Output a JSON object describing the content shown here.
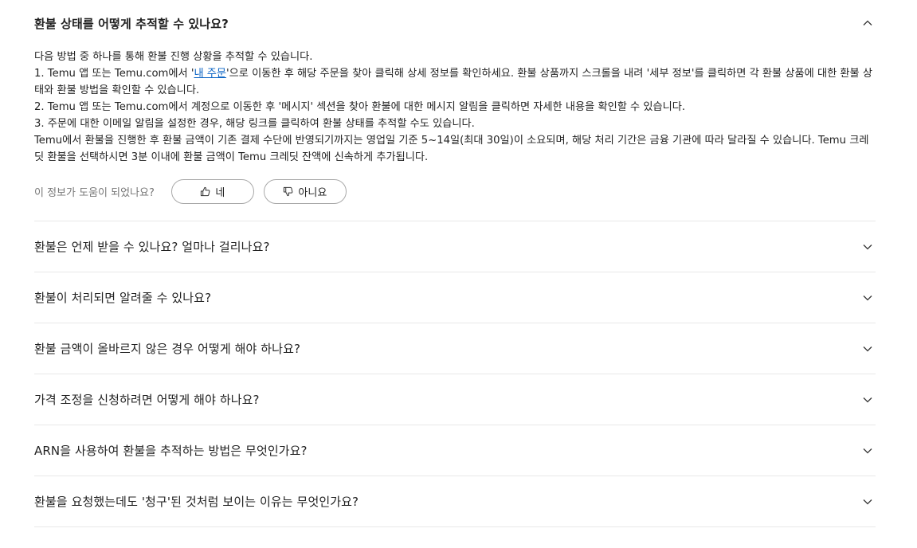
{
  "faq": {
    "open_item": {
      "question": "환불 상태를 어떻게 추적할 수 있나요?",
      "answer_lines": {
        "l1": "다음 방법 중 하나를 통해 환불 진행 상황을 추적할 수 있습니다.",
        "l2_pre": "1. Temu 앱 또는 Temu.com에서 '",
        "l2_link": "내 주문",
        "l2_post": "'으로 이동한 후 해당 주문을 찾아 클릭해 상세 정보를 확인하세요. 환불 상품까지 스크롤을 내려 '세부 정보'를 클릭하면 각 환불 상품에 대한 환불 상태와 환불 방법을 확인할 수 있습니다.",
        "l3": "2. Temu 앱 또는 Temu.com에서 계정으로 이동한 후 '메시지' 섹션을 찾아 환불에 대한 메시지 알림을 클릭하면 자세한 내용을 확인할 수 있습니다.",
        "l4": "3. 주문에 대한 이메일 알림을 설정한 경우, 해당 링크를 클릭하여 환불 상태를 추적할 수도 있습니다.",
        "l5": "Temu에서 환불을 진행한 후 환불 금액이 기존 결제 수단에 반영되기까지는 영업일 기준 5~14일(최대 30일)이 소요되며, 해당 처리 기간은 금융 기관에 따라 달라질 수 있습니다. Temu 크레딧 환불을 선택하시면 3분 이내에 환불 금액이 Temu 크레딧 잔액에 신속하게 추가됩니다."
      },
      "feedback": {
        "label": "이 정보가 도움이 되었나요?",
        "yes": "네",
        "no": "아니요"
      }
    },
    "items": [
      {
        "question": "환불은 언제 받을 수 있나요? 얼마나 걸리나요?"
      },
      {
        "question": "환불이 처리되면 알려줄 수 있나요?"
      },
      {
        "question": "환불 금액이 올바르지 않은 경우 어떻게 해야 하나요?"
      },
      {
        "question": "가격 조정을 신청하려면 어떻게 해야 하나요?"
      },
      {
        "question": "ARN을 사용하여 환불을 추적하는 방법은 무엇인가요?"
      },
      {
        "question": "환불을 요청했는데도 '청구'된 것처럼 보이는 이유는 무엇인가요?"
      }
    ],
    "icons": {
      "expanded": "chevron-up-icon",
      "collapsed": "chevron-down-icon",
      "yes": "thumbs-up-icon",
      "no": "thumbs-down-icon"
    },
    "colors": {
      "link": "#0a63c4",
      "divider": "#e8e8e8",
      "muted": "#777777"
    }
  }
}
